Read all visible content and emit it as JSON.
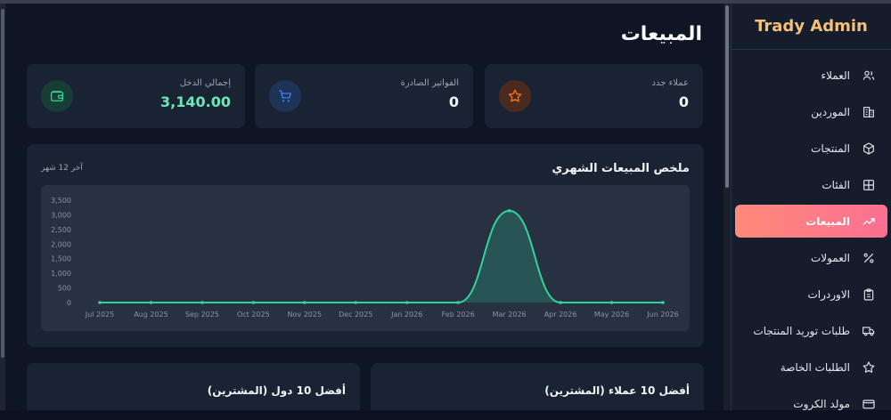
{
  "brand": "Trady Admin",
  "page_title": "المبيعات",
  "sidebar": {
    "items": [
      {
        "label": "العملاء",
        "icon": "users-icon"
      },
      {
        "label": "الموردين",
        "icon": "building-icon"
      },
      {
        "label": "المنتجات",
        "icon": "box-icon"
      },
      {
        "label": "الفئات",
        "icon": "grid-icon"
      },
      {
        "label": "المبيعات",
        "icon": "trending-up-icon",
        "active": true
      },
      {
        "label": "العمولات",
        "icon": "percent-icon"
      },
      {
        "label": "الاوردرات",
        "icon": "clipboard-icon"
      },
      {
        "label": "طلبات توريد المنتجات",
        "icon": "truck-icon"
      },
      {
        "label": "الطلبات الخاصة",
        "icon": "star-icon"
      },
      {
        "label": "مولد الكروت",
        "icon": "card-icon"
      }
    ]
  },
  "stats": {
    "new_customers": {
      "label": "عملاء جدد",
      "value": "0",
      "icon": "star-icon",
      "color": "#f97316"
    },
    "invoices": {
      "label": "الفواتير الصادرة",
      "value": "0",
      "icon": "cart-icon",
      "color": "#3b82f6"
    },
    "income": {
      "label": "إجمالي الدخل",
      "value": "3,140.00",
      "icon": "wallet-icon",
      "color": "#34d399"
    }
  },
  "chart": {
    "title": "ملخص المبيعات الشهري",
    "subtitle": "آخر 12 شهر"
  },
  "chart_data": {
    "type": "area",
    "categories": [
      "Jul 2025",
      "Aug 2025",
      "Sep 2025",
      "Oct 2025",
      "Nov 2025",
      "Dec 2025",
      "Jan 2026",
      "Feb 2026",
      "Mar 2026",
      "Apr 2026",
      "May 2026",
      "Jun 2026"
    ],
    "values": [
      0,
      0,
      0,
      0,
      0,
      0,
      0,
      0,
      3140,
      0,
      0,
      0
    ],
    "yticks": [
      0,
      500,
      1000,
      1500,
      2000,
      2500,
      3000,
      3500
    ],
    "ylim": [
      0,
      3500
    ],
    "color": "#34d399",
    "grid": false
  },
  "bottom": {
    "top_customers": "أفضل 10 عملاء (المشترين)",
    "top_countries": "أفضل 10 دول (المشترين)"
  }
}
